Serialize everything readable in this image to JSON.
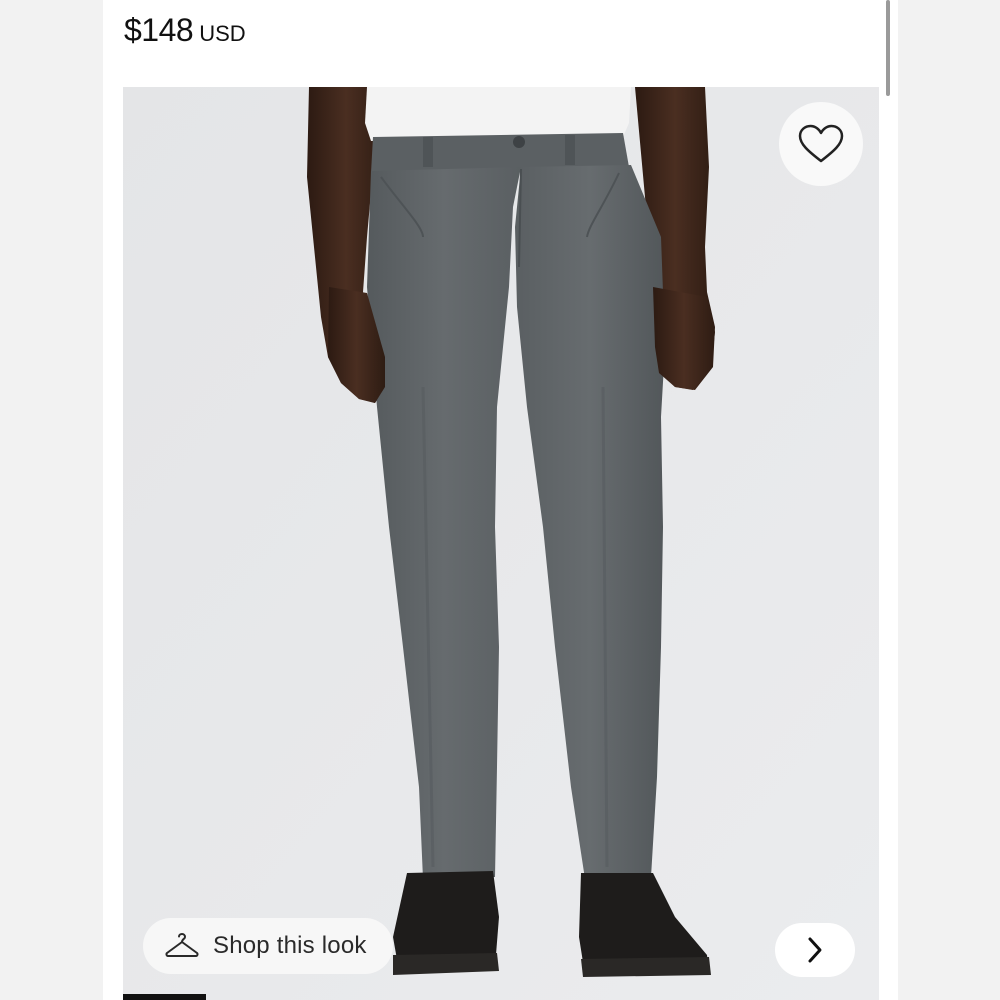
{
  "product": {
    "price_amount": "$148",
    "price_currency": "USD"
  },
  "image": {
    "alt": "Model wearing grey five-pocket pants with black sneakers",
    "wishlist_icon": "heart-outline-icon",
    "shop_look": {
      "icon": "hanger-icon",
      "label": "Shop this look"
    },
    "next_icon": "chevron-right-icon",
    "carousel_progress": 0.11
  },
  "colors": {
    "pants": "#5f6467",
    "background": "#e7e8ea",
    "shirt": "#f4f4f4",
    "skin": "#3a2419",
    "shoes": "#1c1a19"
  }
}
